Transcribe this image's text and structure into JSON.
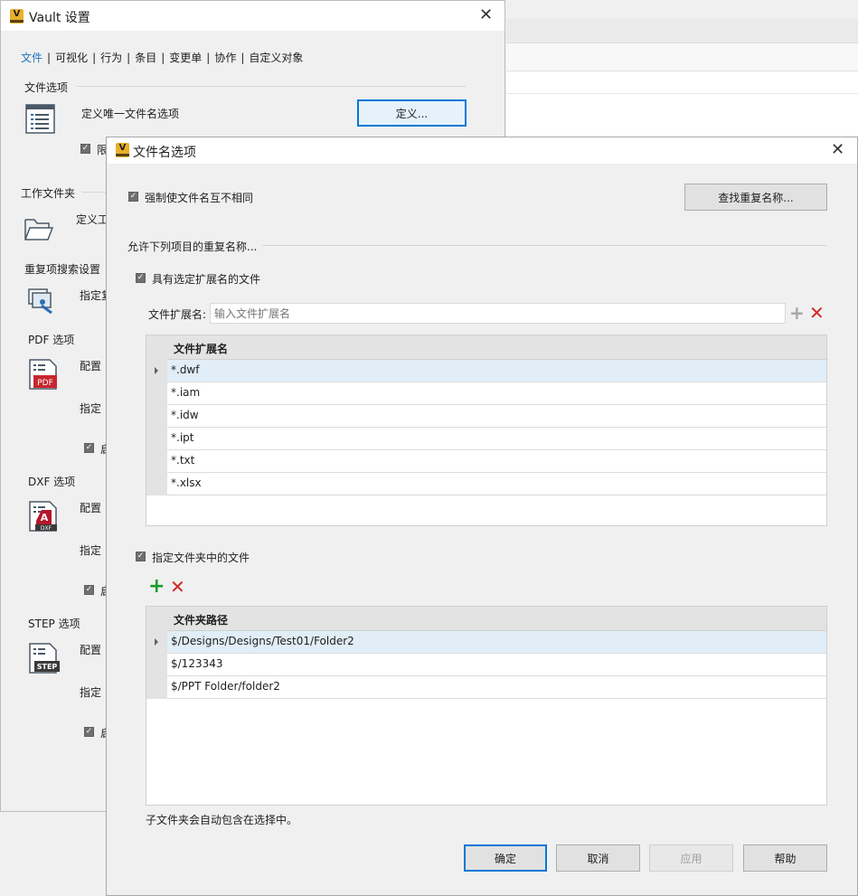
{
  "main_dialog": {
    "title": "Vault 设置",
    "icon_letter": "V",
    "tabs": [
      "文件",
      "可视化",
      "行为",
      "条目",
      "变更单",
      "协作",
      "自定义对象"
    ],
    "sections": {
      "file_options": "文件选项",
      "define_unique_label": "定义唯一文件名选项",
      "define_button": "定义...",
      "limit_checkbox_fragment": "限",
      "work_folder": "工作文件夹",
      "work_folder_row": "定义工",
      "duplicate_search": "重复项搜索设置",
      "duplicate_row": "指定复",
      "pdf": "PDF 选项",
      "pdf_row1": "配置",
      "pdf_row2": "指定",
      "pdf_check": "启",
      "dxf": "DXF 选项",
      "dxf_row1": "配置",
      "dxf_row2": "指定",
      "dxf_check": "启",
      "step": "STEP 选项",
      "step_row1": "配置",
      "step_row2": "指定",
      "step_check": "启"
    },
    "icon_labels": {
      "pdf": "PDF",
      "dxf": "DXF",
      "step": "STEP"
    }
  },
  "filename_dialog": {
    "title": "文件名选项",
    "icon_letter": "V",
    "enforce_unique": "强制使文件名互不相同",
    "find_duplicates_button": "查找重复名称...",
    "allow_duplicates_section": "允许下列项目的重复名称...",
    "ext_checkbox": "具有选定扩展名的文件",
    "ext_label": "文件扩展名:",
    "ext_placeholder": "输入文件扩展名",
    "ext_column": "文件扩展名",
    "extensions": [
      "*.dwf",
      "*.iam",
      "*.idw",
      "*.ipt",
      "*.txt",
      "*.xlsx"
    ],
    "folder_checkbox": "指定文件夹中的文件",
    "folder_column": "文件夹路径",
    "folders": [
      "$/Designs/Designs/Test01/Folder2",
      "$/123343",
      "$/PPT Folder/folder2"
    ],
    "subfolder_note": "子文件夹会自动包含在选择中。",
    "buttons": {
      "ok": "确定",
      "cancel": "取消",
      "apply": "应用",
      "help": "帮助"
    }
  },
  "colors": {
    "accent": "#1e73be",
    "focus": "#0078d7",
    "add_green": "#1a9c2f",
    "remove_red": "#d32626",
    "selected_row": "#e1eef7",
    "app_icon": "#e8b02a"
  }
}
